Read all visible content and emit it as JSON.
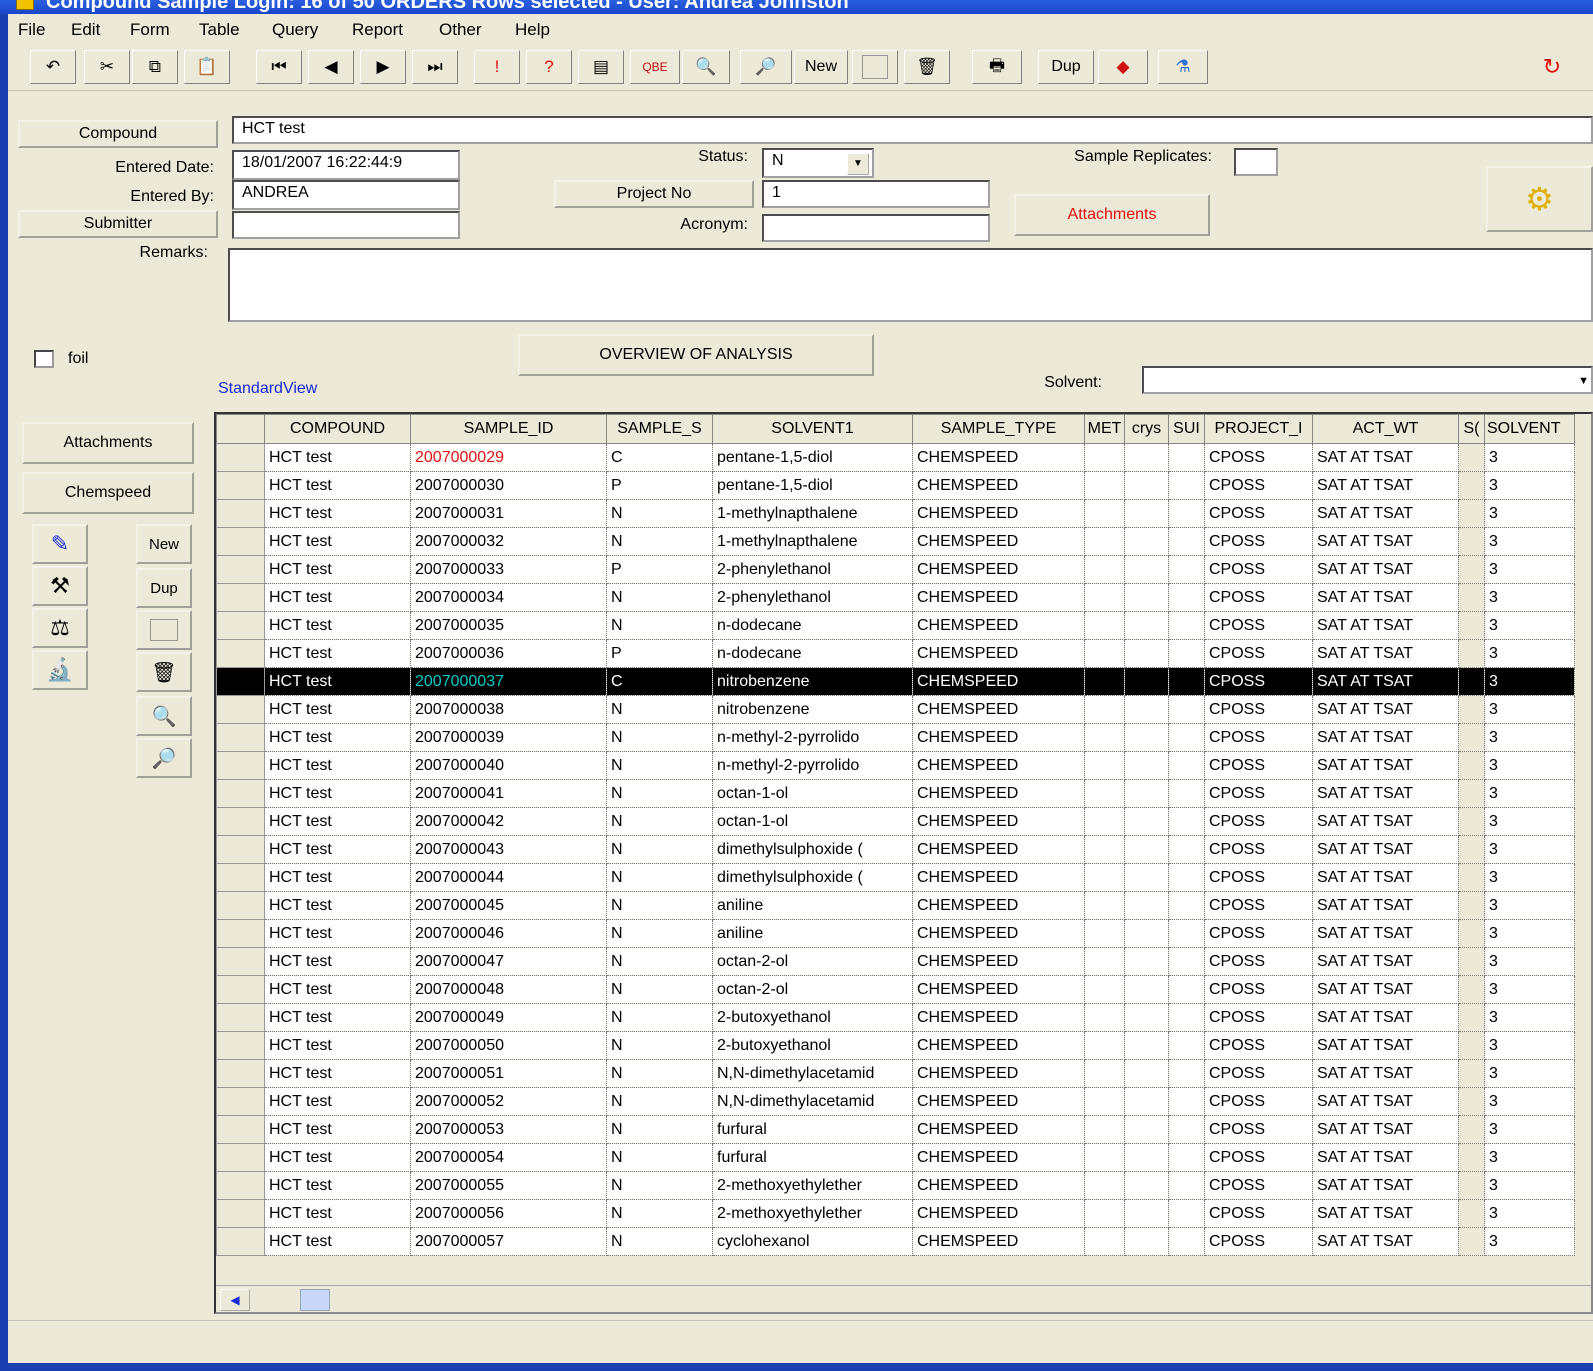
{
  "window": {
    "title": "Compound Sample Login:   16 of 50 ORDERS  Rows selected - User: Andrea Johnston"
  },
  "menu": [
    "File",
    "Edit",
    "Form",
    "Table",
    "Query",
    "Report",
    "Other",
    "Help"
  ],
  "toolbar": {
    "new_label": "New",
    "dup_label": "Dup"
  },
  "form": {
    "compound_label": "Compound",
    "compound_value": "HCT test",
    "entered_date_label": "Entered Date:",
    "entered_date_value": "18/01/2007 16:22:44:9",
    "entered_by_label": "Entered By:",
    "entered_by_value": "ANDREA",
    "submitter_label": "Submitter",
    "submitter_value": "",
    "status_label": "Status:",
    "status_value": "N",
    "project_no_label": "Project No",
    "project_no_value": "1",
    "acronym_label": "Acronym:",
    "acronym_value": "",
    "sample_replicates_label": "Sample Replicates:",
    "sample_replicates_value": "",
    "attachments_label": "Attachments",
    "remarks_label": "Remarks:",
    "remarks_value": "",
    "foil_label": "foil",
    "overview_label": "OVERVIEW OF ANALYSIS",
    "standard_view_label": "StandardView",
    "solvent_label": "Solvent:",
    "solvent_value": ""
  },
  "side": {
    "attachments_label": "Attachments",
    "chemspeed_label": "Chemspeed",
    "new_label": "New",
    "dup_label": "Dup"
  },
  "grid": {
    "columns": [
      "COMPOUND",
      "SAMPLE_ID",
      "SAMPLE_S",
      "SOLVENT1",
      "SAMPLE_TYPE",
      "MET",
      "crys",
      "SUI",
      "PROJECT_I",
      "ACT_WT",
      "S(",
      "SOLVENT"
    ],
    "rows": [
      [
        "HCT test",
        "2007000029",
        "C",
        "pentane-1,5-diol",
        "CHEMSPEED",
        "",
        "",
        "",
        "CPOSS",
        "SAT AT TSAT",
        "",
        "3"
      ],
      [
        "HCT test",
        "2007000030",
        "P",
        "pentane-1,5-diol",
        "CHEMSPEED",
        "",
        "",
        "",
        "CPOSS",
        "SAT AT TSAT",
        "",
        "3"
      ],
      [
        "HCT test",
        "2007000031",
        "N",
        "1-methylnapthalene",
        "CHEMSPEED",
        "",
        "",
        "",
        "CPOSS",
        "SAT AT TSAT",
        "",
        "3"
      ],
      [
        "HCT test",
        "2007000032",
        "N",
        "1-methylnapthalene",
        "CHEMSPEED",
        "",
        "",
        "",
        "CPOSS",
        "SAT AT TSAT",
        "",
        "3"
      ],
      [
        "HCT test",
        "2007000033",
        "P",
        "2-phenylethanol",
        "CHEMSPEED",
        "",
        "",
        "",
        "CPOSS",
        "SAT AT TSAT",
        "",
        "3"
      ],
      [
        "HCT test",
        "2007000034",
        "N",
        "2-phenylethanol",
        "CHEMSPEED",
        "",
        "",
        "",
        "CPOSS",
        "SAT AT TSAT",
        "",
        "3"
      ],
      [
        "HCT test",
        "2007000035",
        "N",
        "n-dodecane",
        "CHEMSPEED",
        "",
        "",
        "",
        "CPOSS",
        "SAT AT TSAT",
        "",
        "3"
      ],
      [
        "HCT test",
        "2007000036",
        "P",
        "n-dodecane",
        "CHEMSPEED",
        "",
        "",
        "",
        "CPOSS",
        "SAT AT TSAT",
        "",
        "3"
      ],
      [
        "HCT test",
        "2007000037",
        "C",
        "nitrobenzene",
        "CHEMSPEED",
        "",
        "",
        "",
        "CPOSS",
        "SAT AT TSAT",
        "",
        "3"
      ],
      [
        "HCT test",
        "2007000038",
        "N",
        "nitrobenzene",
        "CHEMSPEED",
        "",
        "",
        "",
        "CPOSS",
        "SAT AT TSAT",
        "",
        "3"
      ],
      [
        "HCT test",
        "2007000039",
        "N",
        "n-methyl-2-pyrrolido",
        "CHEMSPEED",
        "",
        "",
        "",
        "CPOSS",
        "SAT AT TSAT",
        "",
        "3"
      ],
      [
        "HCT test",
        "2007000040",
        "N",
        "n-methyl-2-pyrrolido",
        "CHEMSPEED",
        "",
        "",
        "",
        "CPOSS",
        "SAT AT TSAT",
        "",
        "3"
      ],
      [
        "HCT test",
        "2007000041",
        "N",
        "octan-1-ol",
        "CHEMSPEED",
        "",
        "",
        "",
        "CPOSS",
        "SAT AT TSAT",
        "",
        "3"
      ],
      [
        "HCT test",
        "2007000042",
        "N",
        "octan-1-ol",
        "CHEMSPEED",
        "",
        "",
        "",
        "CPOSS",
        "SAT AT TSAT",
        "",
        "3"
      ],
      [
        "HCT test",
        "2007000043",
        "N",
        "dimethylsulphoxide (",
        "CHEMSPEED",
        "",
        "",
        "",
        "CPOSS",
        "SAT AT TSAT",
        "",
        "3"
      ],
      [
        "HCT test",
        "2007000044",
        "N",
        "dimethylsulphoxide (",
        "CHEMSPEED",
        "",
        "",
        "",
        "CPOSS",
        "SAT AT TSAT",
        "",
        "3"
      ],
      [
        "HCT test",
        "2007000045",
        "N",
        "aniline",
        "CHEMSPEED",
        "",
        "",
        "",
        "CPOSS",
        "SAT AT TSAT",
        "",
        "3"
      ],
      [
        "HCT test",
        "2007000046",
        "N",
        "aniline",
        "CHEMSPEED",
        "",
        "",
        "",
        "CPOSS",
        "SAT AT TSAT",
        "",
        "3"
      ],
      [
        "HCT test",
        "2007000047",
        "N",
        "octan-2-ol",
        "CHEMSPEED",
        "",
        "",
        "",
        "CPOSS",
        "SAT AT TSAT",
        "",
        "3"
      ],
      [
        "HCT test",
        "2007000048",
        "N",
        "octan-2-ol",
        "CHEMSPEED",
        "",
        "",
        "",
        "CPOSS",
        "SAT AT TSAT",
        "",
        "3"
      ],
      [
        "HCT test",
        "2007000049",
        "N",
        "2-butoxyethanol",
        "CHEMSPEED",
        "",
        "",
        "",
        "CPOSS",
        "SAT AT TSAT",
        "",
        "3"
      ],
      [
        "HCT test",
        "2007000050",
        "N",
        "2-butoxyethanol",
        "CHEMSPEED",
        "",
        "",
        "",
        "CPOSS",
        "SAT AT TSAT",
        "",
        "3"
      ],
      [
        "HCT test",
        "2007000051",
        "N",
        "N,N-dimethylacetamid",
        "CHEMSPEED",
        "",
        "",
        "",
        "CPOSS",
        "SAT AT TSAT",
        "",
        "3"
      ],
      [
        "HCT test",
        "2007000052",
        "N",
        "N,N-dimethylacetamid",
        "CHEMSPEED",
        "",
        "",
        "",
        "CPOSS",
        "SAT AT TSAT",
        "",
        "3"
      ],
      [
        "HCT test",
        "2007000053",
        "N",
        "furfural",
        "CHEMSPEED",
        "",
        "",
        "",
        "CPOSS",
        "SAT AT TSAT",
        "",
        "3"
      ],
      [
        "HCT test",
        "2007000054",
        "N",
        "furfural",
        "CHEMSPEED",
        "",
        "",
        "",
        "CPOSS",
        "SAT AT TSAT",
        "",
        "3"
      ],
      [
        "HCT test",
        "2007000055",
        "N",
        "2-methoxyethylether",
        "CHEMSPEED",
        "",
        "",
        "",
        "CPOSS",
        "SAT AT TSAT",
        "",
        "3"
      ],
      [
        "HCT test",
        "2007000056",
        "N",
        "2-methoxyethylether",
        "CHEMSPEED",
        "",
        "",
        "",
        "CPOSS",
        "SAT AT TSAT",
        "",
        "3"
      ],
      [
        "HCT test",
        "2007000057",
        "N",
        "cyclohexanol",
        "CHEMSPEED",
        "",
        "",
        "",
        "CPOSS",
        "SAT AT TSAT",
        "",
        "3"
      ]
    ],
    "selected_row": 8,
    "red_id_row": 0
  },
  "colors": {
    "selected_bg": "#000000",
    "selected_id": "#00cccc",
    "red_text": "#e01010",
    "link_blue": "#1a2bd6"
  }
}
